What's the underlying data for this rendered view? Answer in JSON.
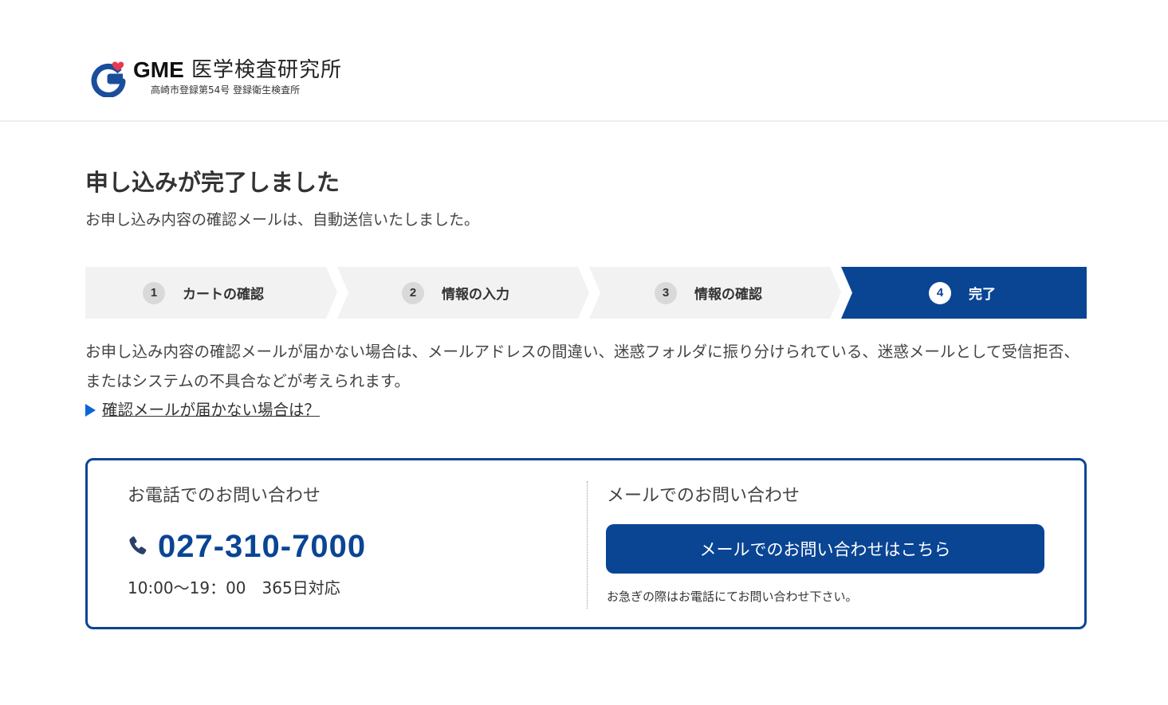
{
  "header": {
    "logo_brand": "GME",
    "logo_name": "医学検査研究所",
    "logo_subtitle": "高崎市登録第54号  登録衛生検査所"
  },
  "main": {
    "title": "申し込みが完了しました",
    "subtitle": "お申し込み内容の確認メールは、自動送信いたしました。"
  },
  "steps": [
    {
      "num": "1",
      "label": "カートの確認",
      "active": false
    },
    {
      "num": "2",
      "label": "情報の入力",
      "active": false
    },
    {
      "num": "3",
      "label": "情報の確認",
      "active": false
    },
    {
      "num": "4",
      "label": "完了",
      "active": true
    }
  ],
  "notice": {
    "text": "お申し込み内容の確認メールが届かない場合は、メールアドレスの間違い、迷惑フォルダに振り分けられている、迷惑メールとして受信拒否、またはシステムの不具合などが考えられます。",
    "link_label": "確認メールが届かない場合は？"
  },
  "contact": {
    "tel_heading": "お電話でのお問い合わせ",
    "tel_number": "027-310-7000",
    "tel_hours": "10:00〜19：00　365日対応",
    "mail_heading": "メールでのお問い合わせ",
    "mail_button_label": "メールでのお問い合わせはこちら",
    "mail_note": "お急ぎの際はお電話にてお問い合わせ下さい。"
  },
  "colors": {
    "accent": "#0a4594",
    "step_bg": "#f2f2f2",
    "link_arrow": "#0a66d6",
    "logo_heart": "#e8384f"
  },
  "icons": {
    "logo": "gme-logo-icon",
    "phone": "phone-icon",
    "arrow": "triangle-right-icon"
  }
}
